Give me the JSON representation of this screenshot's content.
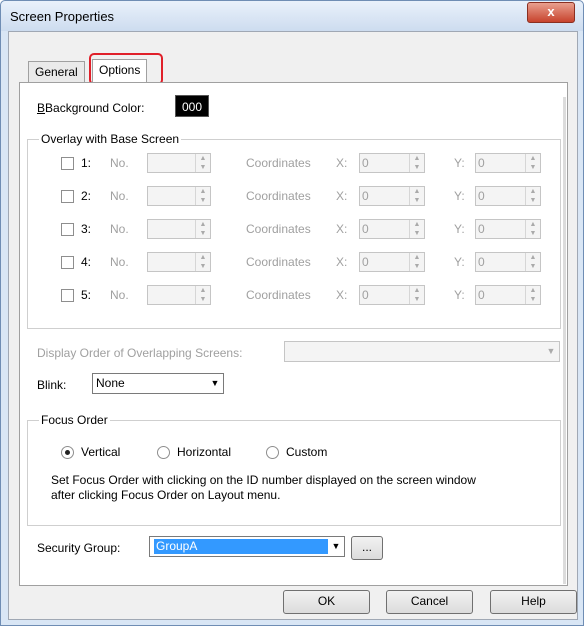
{
  "window": {
    "title": "Screen Properties",
    "close_glyph": "x"
  },
  "tabs": [
    {
      "label": "General"
    },
    {
      "label": "Options"
    }
  ],
  "background": {
    "label": "Background Color:",
    "value": "000",
    "swatch_color": "#000000"
  },
  "overlay": {
    "title": "Overlay with Base Screen",
    "rows": [
      {
        "num": "1:",
        "no_label": "No.",
        "coord_label": "Coordinates",
        "x_label": "X:",
        "x": "0",
        "y_label": "Y:",
        "y": "0"
      },
      {
        "num": "2:",
        "no_label": "No.",
        "coord_label": "Coordinates",
        "x_label": "X:",
        "x": "0",
        "y_label": "Y:",
        "y": "0"
      },
      {
        "num": "3:",
        "no_label": "No.",
        "coord_label": "Coordinates",
        "x_label": "X:",
        "x": "0",
        "y_label": "Y:",
        "y": "0"
      },
      {
        "num": "4:",
        "no_label": "No.",
        "coord_label": "Coordinates",
        "x_label": "X:",
        "x": "0",
        "y_label": "Y:",
        "y": "0"
      },
      {
        "num": "5:",
        "no_label": "No.",
        "coord_label": "Coordinates",
        "x_label": "X:",
        "x": "0",
        "y_label": "Y:",
        "y": "0"
      }
    ]
  },
  "display_order": {
    "label": "Display Order of Overlapping Screens:",
    "value": ""
  },
  "blink": {
    "label": "Blink:",
    "value": "None"
  },
  "focus": {
    "title": "Focus Order",
    "options": [
      "Vertical",
      "Horizontal",
      "Custom"
    ],
    "selected": "Vertical",
    "note_line1": "Set Focus Order with clicking on the ID number displayed on the screen window",
    "note_line2": "after clicking Focus Order on Layout menu."
  },
  "security": {
    "label": "Security Group:",
    "value": "GroupA",
    "browse": "..."
  },
  "buttons": {
    "ok": "OK",
    "cancel": "Cancel",
    "help": "Help"
  }
}
